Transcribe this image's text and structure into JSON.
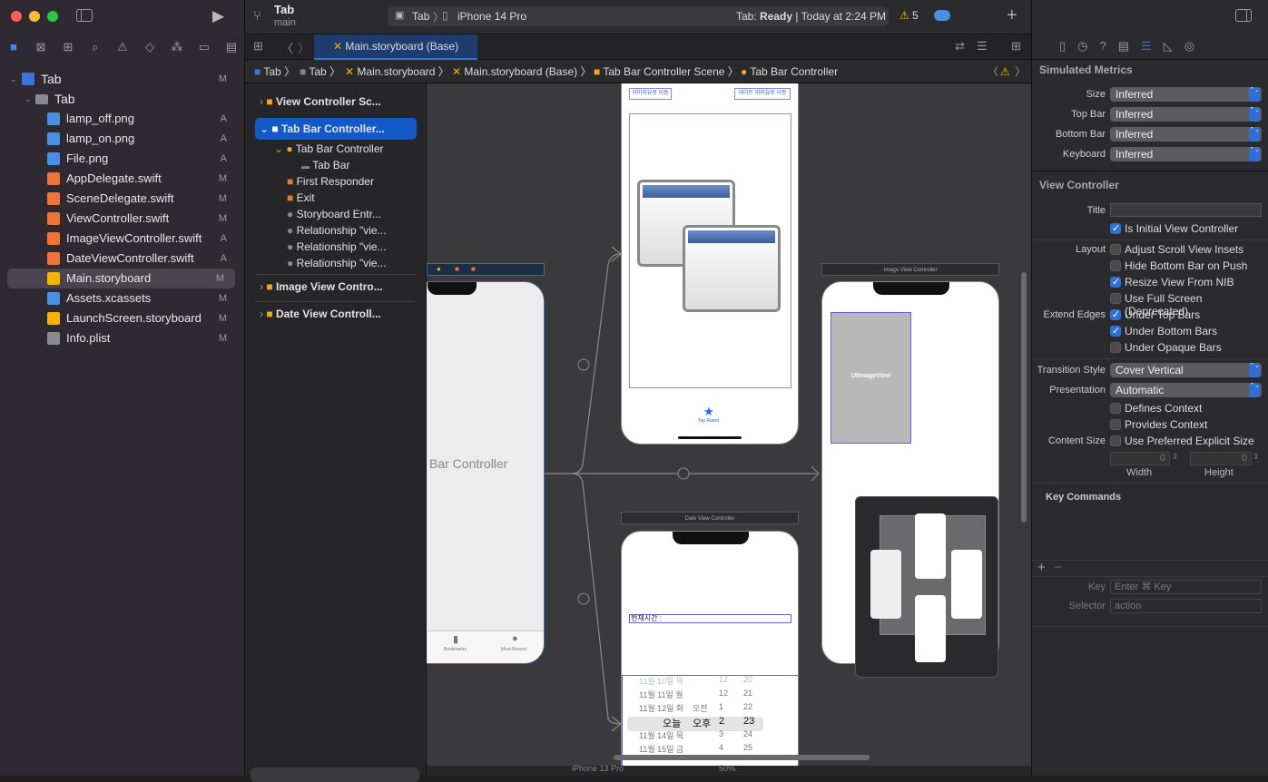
{
  "sidebar": {
    "project": "Tab",
    "project_badge": "M",
    "group": "Tab",
    "files": [
      {
        "name": "lamp_off.png",
        "badge": "A"
      },
      {
        "name": "lamp_on.png",
        "badge": "A"
      },
      {
        "name": "File.png",
        "badge": "A"
      },
      {
        "name": "AppDelegate.swift",
        "badge": "M"
      },
      {
        "name": "SceneDelegate.swift",
        "badge": "M"
      },
      {
        "name": "ViewController.swift",
        "badge": "M"
      },
      {
        "name": "ImageViewController.swift",
        "badge": "A"
      },
      {
        "name": "DateViewController.swift",
        "badge": "A"
      },
      {
        "name": "Main.storyboard",
        "badge": "M"
      },
      {
        "name": "Assets.xcassets",
        "badge": "M"
      },
      {
        "name": "LaunchScreen.storyboard",
        "badge": "M"
      },
      {
        "name": "Info.plist",
        "badge": "M"
      }
    ]
  },
  "toolbar": {
    "project": "Tab",
    "branch": "main",
    "scheme": "Tab",
    "device": "iPhone 14 Pro",
    "status_prefix": "Tab:",
    "status_bold": "Ready",
    "status_time": "| Today at 2:24 PM",
    "warnings": "5"
  },
  "tab": {
    "label": "Main.storyboard (Base)"
  },
  "jumpbar": [
    "Tab",
    "Tab",
    "Main.storyboard",
    "Main.storyboard (Base)",
    "Tab Bar Controller Scene",
    "Tab Bar Controller"
  ],
  "outline": {
    "items": [
      "View Controller Sc...",
      "Tab Bar Controller...",
      "Tab Bar Controller",
      "Tab Bar",
      "First Responder",
      "Exit",
      "Storyboard Entr...",
      "Relationship \"vie...",
      "Relationship \"vie...",
      "Relationship \"vie...",
      "Image View Contro...",
      "Date View Controll..."
    ]
  },
  "canvas": {
    "tbc_label": "Bar Controller",
    "btn_image": "이미지뷰로 이동",
    "btn_date": "데이트 피커뷰로 이동",
    "tab_item": "Top Rated",
    "image_vc_title": "Image View Controller",
    "uiimageview": "UIImageView",
    "date_vc_title": "Date View Controller",
    "current_time": "현재시간 :",
    "bookmarks": "Bookmarks",
    "most_recent": "Most Recent",
    "picker_rows": [
      [
        "11월 10일 목",
        "",
        "12",
        "20"
      ],
      [
        "11월 11일 월",
        "",
        "12",
        "21"
      ],
      [
        "11월 12일 화",
        "오전",
        "1",
        "22"
      ],
      [
        "오늘",
        "오후",
        "2",
        "23"
      ],
      [
        "11월 14일 목",
        "",
        "3",
        "24"
      ],
      [
        "11월 15일 금",
        "",
        "4",
        "25"
      ]
    ],
    "zoom": "50%",
    "device_bottom": "iPhone 13 Pro"
  },
  "inspector": {
    "simulated_metrics": "Simulated Metrics",
    "size_label": "Size",
    "size": "Inferred",
    "topbar_label": "Top Bar",
    "topbar": "Inferred",
    "bottombar_label": "Bottom Bar",
    "bottombar": "Inferred",
    "keyboard_label": "Keyboard",
    "keyboard": "Inferred",
    "view_controller": "View Controller",
    "title_label": "Title",
    "title_value": "",
    "is_initial": "Is Initial View Controller",
    "layout_label": "Layout",
    "adjust_scroll": "Adjust Scroll View Insets",
    "hide_bottom": "Hide Bottom Bar on Push",
    "resize_nib": "Resize View From NIB",
    "full_screen": "Use Full Screen (Deprecated)",
    "extend_label": "Extend Edges",
    "under_top": "Under Top Bars",
    "under_bottom": "Under Bottom Bars",
    "under_opaque": "Under Opaque Bars",
    "transition_label": "Transition Style",
    "transition": "Cover Vertical",
    "presentation_label": "Presentation",
    "presentation": "Automatic",
    "defines_context": "Defines Context",
    "provides_context": "Provides Context",
    "content_size_label": "Content Size",
    "preferred_size": "Use Preferred Explicit Size",
    "width_value": "0",
    "height_value": "0",
    "width_label": "Width",
    "height_label": "Height",
    "key_commands": "Key Commands",
    "key_label": "Key",
    "key_placeholder": "Enter ⌘ Key",
    "selector_label": "Selector",
    "selector_placeholder": "action",
    "accent": "#2f6fd6"
  }
}
